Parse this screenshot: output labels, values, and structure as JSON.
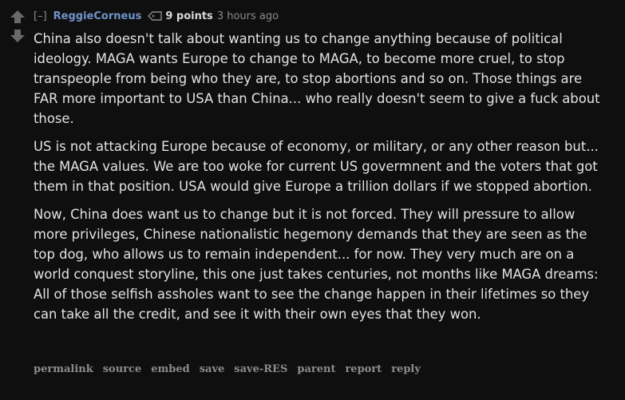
{
  "comment": {
    "expand_label": "[–]",
    "author": "ReggieCorneus",
    "score": "9 points",
    "time": "3 hours ago",
    "paragraphs": [
      "China also doesn't talk about wanting us to change anything because of political ideology. MAGA wants Europe to change to MAGA, to become more cruel, to stop transpeople from being who they are, to stop abortions and so on. Those things are FAR more important to USA than China... who really doesn't seem to give a fuck about those.",
      "US is not attacking Europe because of economy, or military, or any other reason but... the MAGA values. We are too woke for current US govermnent and the voters that got them in that position. USA would give Europe a trillion dollars if we stopped abortion.",
      "Now, China does want us to change but it is not forced. They will pressure to allow more privileges, Chinese nationalistic hegemony demands that they are seen as the top dog, who allows us to remain independent... for now. They very much are on a world conquest storyline, this one just takes centuries, not months like MAGA dreams: All of those selfish assholes want to see the change happen in their lifetimes so they can take all the credit, and see it with their own eyes that they won."
    ],
    "buttons": {
      "permalink": "permalink",
      "source": "source",
      "embed": "embed",
      "save": "save",
      "save_res": "save-RES",
      "parent": "parent",
      "report": "report",
      "reply": "reply"
    }
  },
  "colors": {
    "background": "#0f0f0f",
    "author": "#6f93c9",
    "muted": "#8a8a8a",
    "body_text": "#e2e2e2"
  },
  "icons": {
    "upvote": "upvote-arrow-icon",
    "downvote": "downvote-arrow-icon",
    "tag": "tag-icon"
  }
}
